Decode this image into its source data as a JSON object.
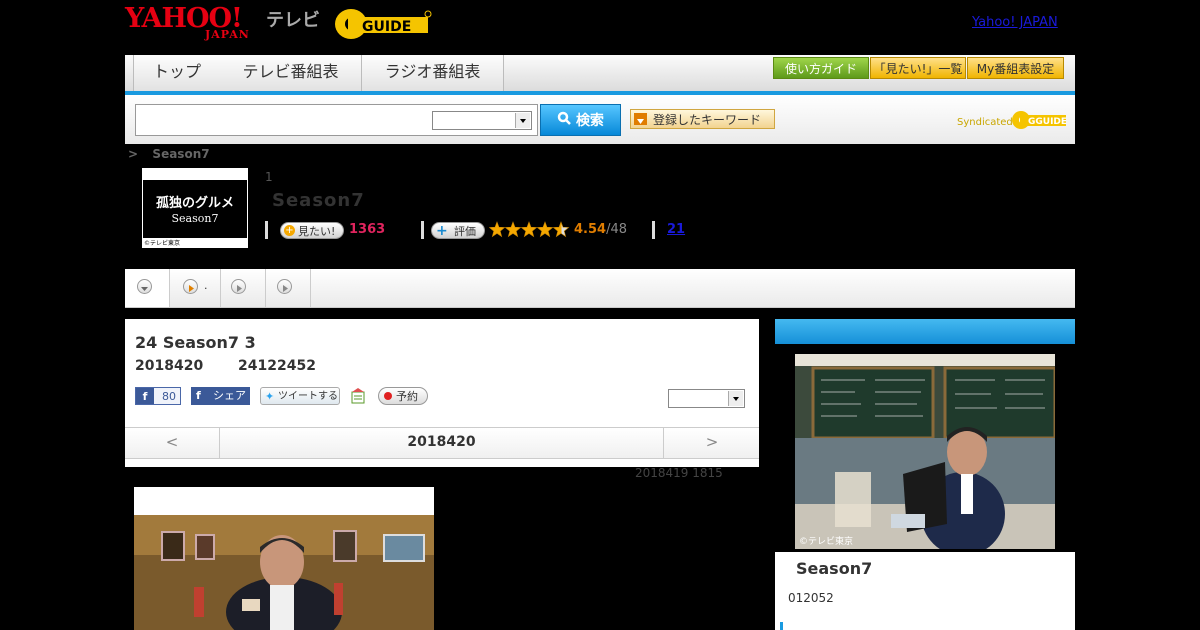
{
  "header": {
    "yahoo_logo": "YAHOO!",
    "yahoo_sub": "JAPAN",
    "tv_label": "テレビ",
    "gguide_logo": "G GUIDE",
    "yahoo_japan_link": "Yahoo! JAPAN"
  },
  "nav": {
    "tabs": [
      {
        "label": "トップ"
      },
      {
        "label": "テレビ番組表"
      },
      {
        "label": "ラジオ番組表"
      }
    ],
    "guide_button": "使い方ガイド",
    "wishlist_button": "「見たい!」一覧",
    "my_schedule_button": "My番組表設定"
  },
  "search": {
    "placeholder": "",
    "button_label": "検索",
    "keyword_button": "登録したキーワード",
    "syndicated_label": "Syndicated",
    "syndicated_logo": "GGUIDE"
  },
  "breadcrumb": {
    "separator": ">",
    "current": "Season7"
  },
  "program": {
    "thumb_title": "孤独のグルメ",
    "thumb_subtitle": "Season7",
    "thumb_copyright": "©テレビ東京",
    "episode_no": "1",
    "title": "Season7",
    "want_label": "見たい!",
    "want_count": "1363",
    "rate_label": "評価",
    "rating": "4.54",
    "rating_count": "/48",
    "rating_value": 4.54,
    "review_link": "21"
  },
  "subnav": {
    "items": [
      {
        "label": ""
      },
      {
        "label": "."
      },
      {
        "label": ""
      },
      {
        "label": ""
      }
    ]
  },
  "episode": {
    "heading": "24 Season7 3",
    "date": "2018420",
    "time": "24122452",
    "fb_count": "80",
    "fb_share": "シェア",
    "tweet": "ツイートする",
    "reserve": "予約",
    "prev": "<",
    "current_date": "2018420",
    "next": ">",
    "updated": "2018419  1815"
  },
  "side": {
    "image_credit": "©テレビ東京",
    "title": "Season7",
    "info": "012052"
  },
  "colors": {
    "accent_blue": "#1a9ae0",
    "want_pink": "#e0245e",
    "rating_orange": "#e07d00"
  }
}
